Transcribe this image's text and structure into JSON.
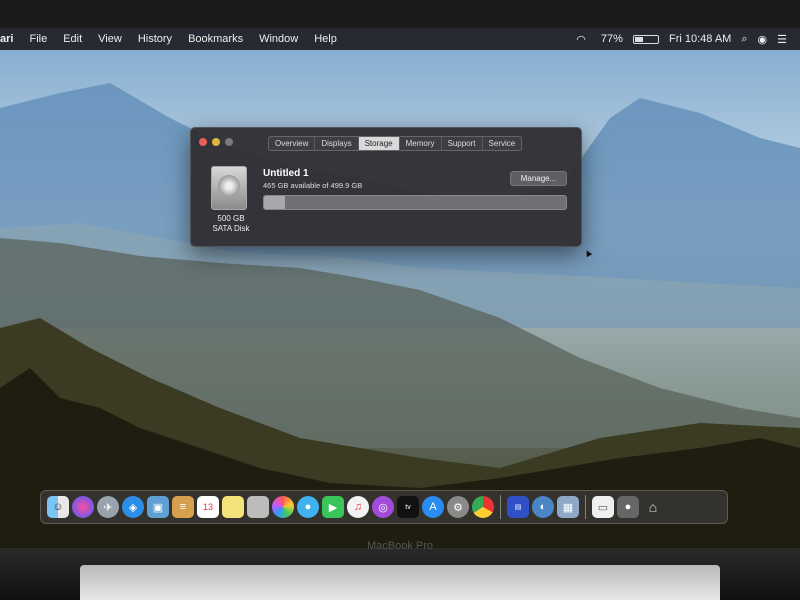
{
  "menubar": {
    "app": "ari",
    "items": [
      "File",
      "Edit",
      "View",
      "History",
      "Bookmarks",
      "Window",
      "Help"
    ],
    "battery_percent": "77%",
    "battery_level": 0.77,
    "clock": "Fri 10:48 AM"
  },
  "window": {
    "tabs": [
      "Overview",
      "Displays",
      "Storage",
      "Memory",
      "Support",
      "Service"
    ],
    "active_tab": "Storage",
    "disk": {
      "size": "500 GB",
      "type": "SATA Disk"
    },
    "volume": {
      "name": "Untitled 1",
      "available": "465 GB available of 499.9 GB",
      "used_fraction": 0.07
    },
    "manage_label": "Manage..."
  },
  "dock": {
    "icons": [
      "finder-icon",
      "siri-icon",
      "launchpad-icon",
      "safari-icon",
      "preview-icon",
      "notes-icon",
      "calendar-icon",
      "stickies-icon",
      "photo-booth-icon",
      "photos-icon",
      "messages-icon",
      "facetime-icon",
      "music-icon",
      "podcasts-icon",
      "tv-icon",
      "app-store-icon",
      "system-preferences-icon",
      "chrome-icon",
      "istat-icon",
      "network-icon",
      "documents-icon",
      "file-icon",
      "control-icon",
      "trash-icon"
    ],
    "calendar_day": "13"
  },
  "device": {
    "brand": "MacBook Pro"
  }
}
